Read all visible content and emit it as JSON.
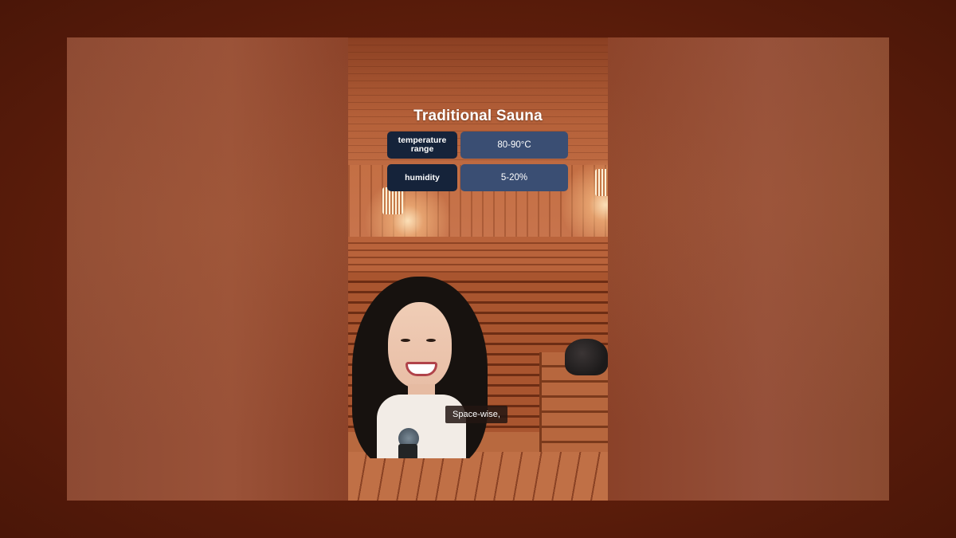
{
  "overlay": {
    "title": "Traditional Sauna",
    "rows": [
      {
        "label": "temperature range",
        "value": "80-90°C"
      },
      {
        "label": "humidity",
        "value": "5-20%"
      }
    ]
  },
  "caption": {
    "text": "Space-wise,"
  },
  "colors": {
    "label_bg": "#15233a",
    "value_bg": "#3a4e73",
    "backdrop": "#5a1e0c"
  }
}
